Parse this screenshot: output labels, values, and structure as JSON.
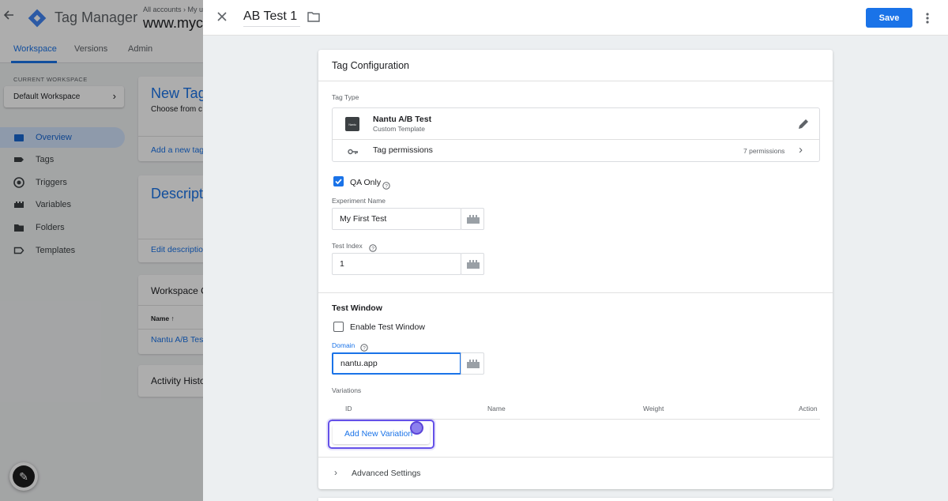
{
  "app": {
    "title": "Tag Manager",
    "breadcrumb": "All accounts › My u",
    "container": "www.myco",
    "nav_tabs": [
      "Workspace",
      "Versions",
      "Admin"
    ],
    "current_workspace_label": "CURRENT WORKSPACE",
    "workspace_name": "Default Workspace",
    "sidebar": [
      {
        "label": "Overview",
        "icon": "overview-icon"
      },
      {
        "label": "Tags",
        "icon": "tag-icon"
      },
      {
        "label": "Triggers",
        "icon": "trigger-icon"
      },
      {
        "label": "Variables",
        "icon": "variables-icon"
      },
      {
        "label": "Folders",
        "icon": "folder-icon"
      },
      {
        "label": "Templates",
        "icon": "template-icon"
      }
    ],
    "cards": {
      "new_tag_title": "New Tag",
      "new_tag_text": "Choose from c",
      "new_tag_link": "Add a new tag",
      "desc_title": "Descript",
      "desc_link": "Edit descriptio",
      "wsc_title": "Workspace C",
      "wsc_col": "Name",
      "wsc_row": "Nantu A/B Test",
      "activity_title": "Activity Histo"
    }
  },
  "editor": {
    "tag_name": "AB Test 1",
    "save_label": "Save",
    "config_title": "Tag Configuration",
    "tag_type_label": "Tag Type",
    "template_name": "Nantu A/B Test",
    "template_subtitle": "Custom Template",
    "template_icon_text": "Nantu",
    "permissions_label": "Tag permissions",
    "permissions_count": "7 permissions",
    "qa_only_label": "QA Only",
    "qa_only_checked": true,
    "experiment_name_label": "Experiment Name",
    "experiment_name_value": "My First Test",
    "test_index_label": "Test Index",
    "test_index_value": "1",
    "test_window_heading": "Test Window",
    "enable_test_window_label": "Enable Test Window",
    "enable_test_window_checked": false,
    "domain_label": "Domain",
    "domain_value": "nantu.app",
    "variations_label": "Variations",
    "variations_columns": [
      "ID",
      "Name",
      "Weight",
      "Action"
    ],
    "add_variation_label": "Add New Variation",
    "advanced_settings_label": "Advanced Settings"
  },
  "colors": {
    "accent": "#1a73e8",
    "highlight": "#6451e8",
    "overlay": "rgba(0,0,0,0.32)"
  }
}
